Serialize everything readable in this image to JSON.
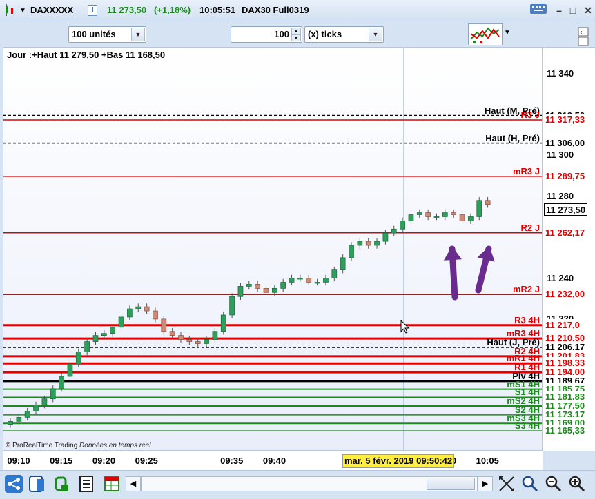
{
  "titlebar": {
    "symbol": "DAXXXXX",
    "price": "11 273,50",
    "change": "(+1,18%)",
    "time": "10:05:51",
    "contract": "DAX30 Full0319",
    "change_color": "#1a8c1a"
  },
  "toolbar": {
    "units_select": "100 unités",
    "ticks_value": "100",
    "ticks_select": "(x) ticks"
  },
  "chart": {
    "header": "Jour :+Haut 11 279,50 +Bas 11 168,50",
    "copyright": "© ProRealTime Trading ",
    "copyright_italic": "Données en temps réel",
    "cursor_date": "mar. 5 févr. 2019 09:50:42",
    "levels": [
      {
        "label": "Haut (M, Pré)",
        "price": "11 319,50",
        "color": "#000000",
        "style": "dashed"
      },
      {
        "label": "R3 J",
        "price": "11 317,33",
        "color": "#e00000",
        "style": "solid"
      },
      {
        "label": "Haut (H, Pré)",
        "price": "11 306,00",
        "color": "#000000",
        "style": "dashed"
      },
      {
        "label": "mR3 J",
        "price": "11 289,75",
        "color": "#e00000",
        "style": "solid"
      },
      {
        "label": "R2 J",
        "price": "11 262,17",
        "color": "#e00000",
        "style": "solid"
      },
      {
        "label": "mR2 J",
        "price": "11 232,00",
        "color": "#e00000",
        "style": "solid"
      },
      {
        "label": "R3 4H",
        "price": "11 217,0",
        "color": "#e00000",
        "style": "solid"
      },
      {
        "label": "mR3 4H",
        "price": "11 210,50",
        "color": "#e00000",
        "style": "solid"
      },
      {
        "label": "Haut (J, Pré)",
        "price": "11 206,17",
        "color": "#000000",
        "style": "dashed"
      },
      {
        "label": "R2 4H",
        "price": "11 201,83",
        "color": "#e00000",
        "style": "solid"
      },
      {
        "label": "mR1 4H",
        "price": "11 198,33",
        "color": "#e00000",
        "style": "solid"
      },
      {
        "label": "R1 4H",
        "price": "11 194,00",
        "color": "#e00000",
        "style": "solid"
      },
      {
        "label": "Piv 4H",
        "price": "11 189,67",
        "color": "#000000",
        "style": "solid"
      },
      {
        "label": "mS1 4H",
        "price": "11 185,75",
        "color": "#1a8c1a",
        "style": "solid"
      },
      {
        "label": "S1 4H",
        "price": "11 181,83",
        "color": "#1a8c1a",
        "style": "solid"
      },
      {
        "label": "mS2 4H",
        "price": "11 177,50",
        "color": "#1a8c1a",
        "style": "solid"
      },
      {
        "label": "S2 4H",
        "price": "11 173,17",
        "color": "#1a8c1a",
        "style": "solid"
      },
      {
        "label": "mS3 4H",
        "price": "11 169,00",
        "color": "#1a8c1a",
        "style": "solid"
      },
      {
        "label": "S3 4H",
        "price": "11 165,33",
        "color": "#1a8c1a",
        "style": "solid"
      }
    ],
    "current_price": "11 273,50",
    "price_ticks": [
      "11 340",
      "11 300",
      "11 280",
      "11 240",
      "11 220"
    ],
    "time_ticks": [
      "09:10",
      "09:15",
      "09:20",
      "09:25",
      "09:35",
      "09:40",
      "10:00",
      "10:05"
    ]
  },
  "chart_data": {
    "type": "candlestick",
    "title": "DAXXXXX",
    "x": [
      "09:09",
      "09:10",
      "09:11",
      "09:12",
      "09:13",
      "09:14",
      "09:15",
      "09:16",
      "09:17",
      "09:18",
      "09:19",
      "09:20",
      "09:21",
      "09:22",
      "09:23",
      "09:24",
      "09:25",
      "09:26",
      "09:27",
      "09:28",
      "09:29",
      "09:30",
      "09:31",
      "09:32",
      "09:33",
      "09:34",
      "09:35",
      "09:36",
      "09:37",
      "09:38",
      "09:39",
      "09:40",
      "09:41",
      "09:42",
      "09:43",
      "09:44",
      "09:45",
      "09:46",
      "09:47",
      "09:48",
      "09:49",
      "09:50",
      "09:51",
      "09:52",
      "09:53",
      "09:54",
      "09:55",
      "09:56",
      "09:57",
      "09:58",
      "09:59",
      "10:00",
      "10:01",
      "10:02",
      "10:03",
      "10:04",
      "10:05"
    ],
    "close": [
      11170,
      11172,
      11175,
      11178,
      11181,
      11186,
      11192,
      11198,
      11204,
      11209,
      11212,
      11213,
      11216,
      11221,
      11225,
      11226,
      11224,
      11220,
      11214,
      11212,
      11210,
      11209,
      11208,
      11210,
      11214,
      11222,
      11231,
      11236,
      11237,
      11235,
      11233,
      11235,
      11238,
      11240,
      11240,
      11238,
      11238,
      11240,
      11244,
      11250,
      11256,
      11258,
      11256,
      11258,
      11262,
      11264,
      11268,
      11271,
      11272,
      11270,
      11270,
      11272,
      11271,
      11268,
      11270,
      11278,
      11276
    ],
    "xlabel": "",
    "ylabel": "",
    "ylim": [
      11160,
      11350
    ]
  },
  "bottombar": {
    "icons": [
      "share-icon",
      "layout-icon",
      "indicator-icon",
      "list-icon",
      "table-icon",
      "zoom-fit-icon",
      "zoom-out-icon",
      "zoom-in-icon"
    ]
  }
}
